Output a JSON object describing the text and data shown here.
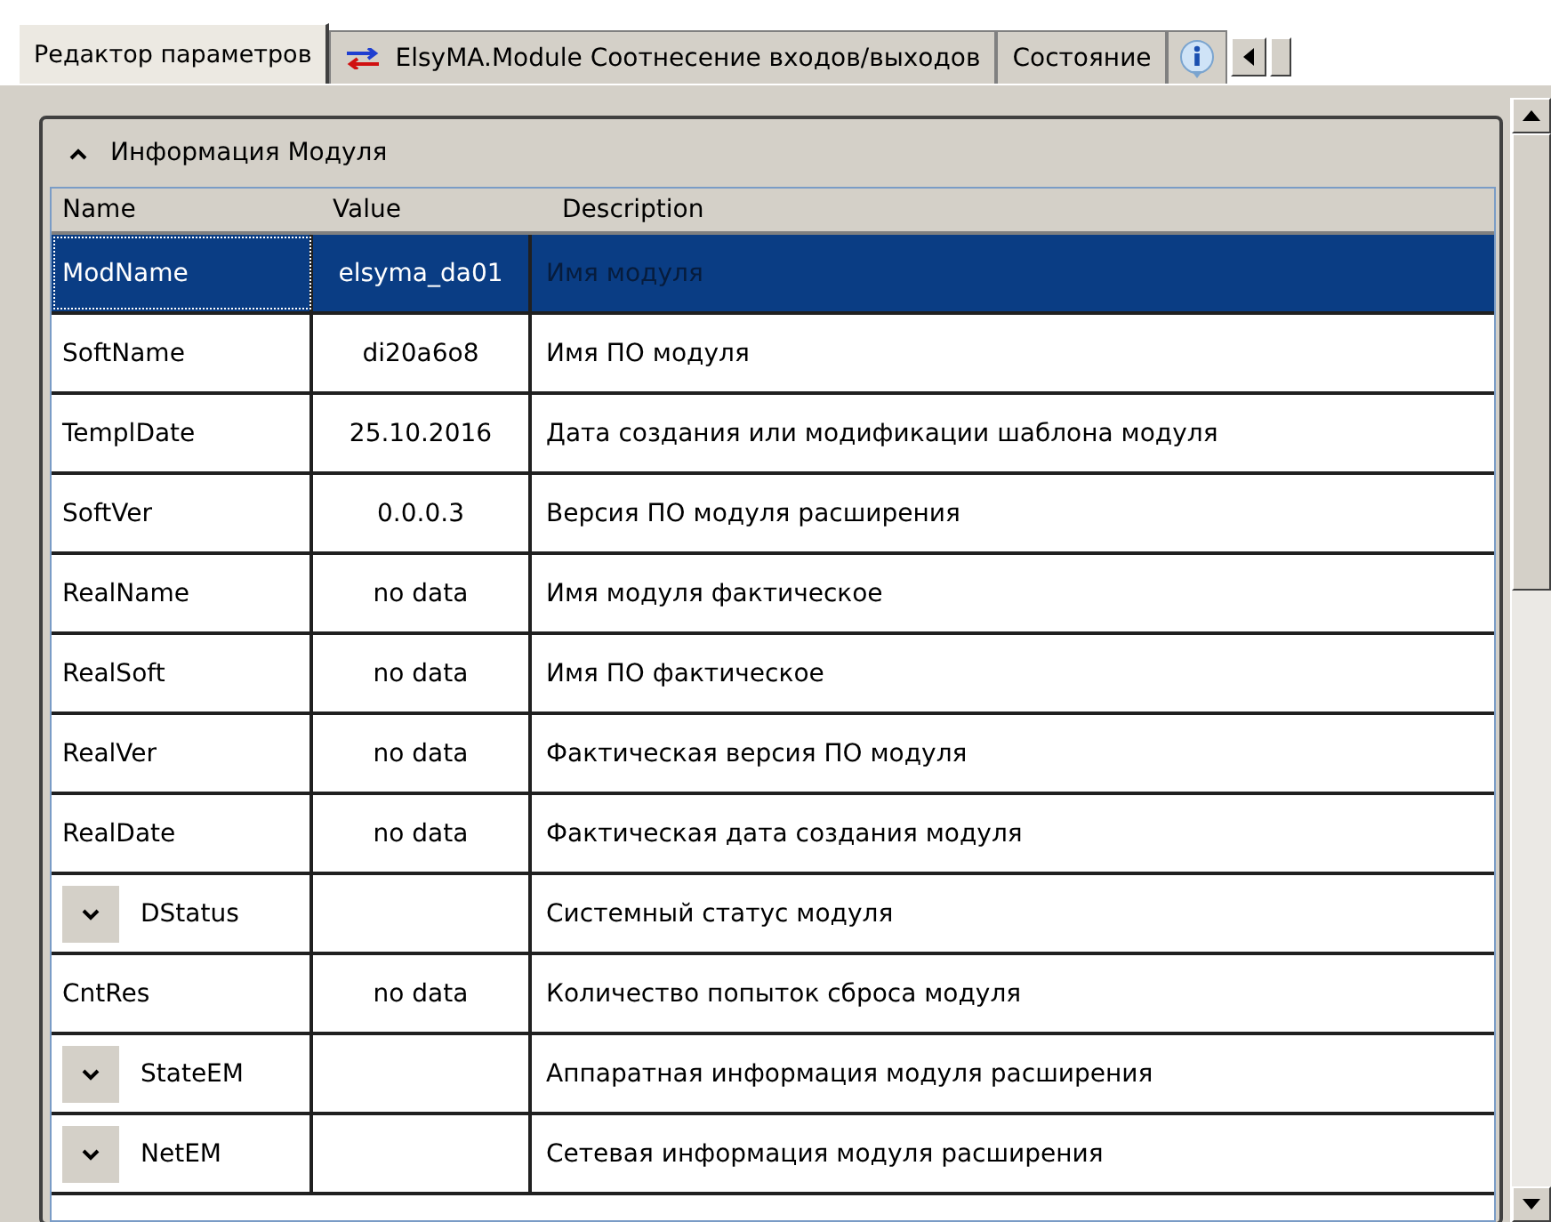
{
  "tabs": [
    {
      "kind": "text",
      "label": "Редактор параметров",
      "selected": true
    },
    {
      "kind": "icon-text",
      "label": "ElsyMA.Module Соотнесение входов/выходов",
      "selected": false
    },
    {
      "kind": "text",
      "label": "Состояние",
      "selected": false
    },
    {
      "kind": "icon",
      "selected": false
    }
  ],
  "section": {
    "title": "Информация Модуля",
    "expanded": true
  },
  "table": {
    "columns": [
      "Name",
      "Value",
      "Description"
    ],
    "rows": [
      {
        "kind": "value",
        "name": "ModName",
        "value": "elsyma_da01",
        "description": "Имя модуля",
        "selected": true
      },
      {
        "kind": "value",
        "name": "SoftName",
        "value": "di20a6o8",
        "description": "Имя ПО модуля",
        "selected": false
      },
      {
        "kind": "value",
        "name": "TemplDate",
        "value": "25.10.2016",
        "description": "Дата создания или модификации шаблона модуля",
        "selected": false
      },
      {
        "kind": "value",
        "name": "SoftVer",
        "value": "0.0.0.3",
        "description": "Версия ПО модуля расширения",
        "selected": false
      },
      {
        "kind": "value",
        "name": "RealName",
        "value": "no data",
        "description": "Имя модуля фактическое",
        "selected": false
      },
      {
        "kind": "value",
        "name": "RealSoft",
        "value": "no data",
        "description": "Имя ПО фактическое",
        "selected": false
      },
      {
        "kind": "value",
        "name": "RealVer",
        "value": "no data",
        "description": "Фактическая версия ПО модуля",
        "selected": false
      },
      {
        "kind": "value",
        "name": "RealDate",
        "value": "no data",
        "description": "Фактическая дата создания модуля",
        "selected": false
      },
      {
        "kind": "group",
        "name": "DStatus",
        "description": "Системный статус модуля",
        "selected": false
      },
      {
        "kind": "value",
        "name": "CntRes",
        "value": "no data",
        "description": "Количество попыток сброса модуля",
        "selected": false
      },
      {
        "kind": "group",
        "name": "StateEM",
        "description": "Аппаратная информация модуля расширения",
        "selected": false
      },
      {
        "kind": "group",
        "name": "NetEM",
        "description": "Сетевая информация модуля расширения",
        "selected": false
      }
    ]
  }
}
